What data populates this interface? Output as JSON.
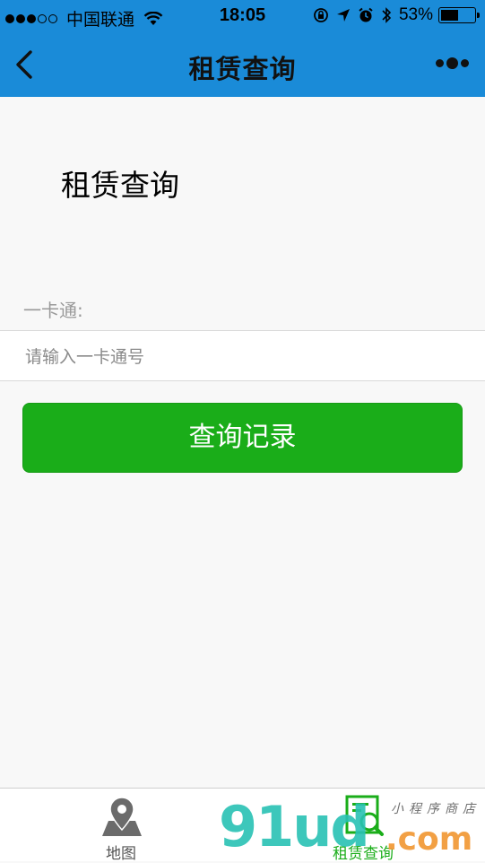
{
  "status_bar": {
    "carrier": "中国联通",
    "time": "18:05",
    "battery": "53%",
    "battery_level": 0.53
  },
  "nav": {
    "title": "租赁查询"
  },
  "main": {
    "heading": "租赁查询",
    "card_label": "一卡通:",
    "input_placeholder": "请输入一卡通号",
    "input_value": "",
    "submit_label": "查询记录"
  },
  "tabbar": {
    "items": [
      {
        "label": "地图",
        "icon": "map-pin-icon",
        "active": false
      },
      {
        "label": "租赁查询",
        "icon": "search-record-icon",
        "active": true
      }
    ]
  },
  "watermark": {
    "brand": "91ud",
    "tld": ".com",
    "tagline": "小程序商店"
  },
  "colors": {
    "header_bg": "#1a8bd8",
    "primary_button": "#1aad19",
    "page_bg": "#f8f8f8",
    "active_tab": "#1aad19"
  }
}
